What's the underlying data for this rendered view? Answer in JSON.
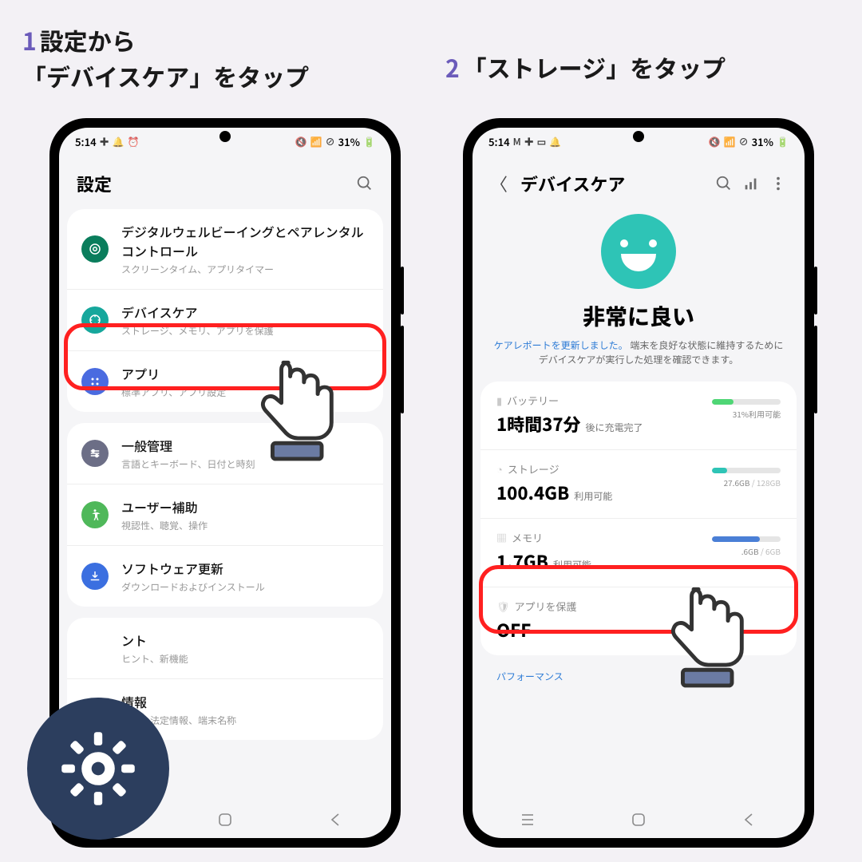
{
  "instructions": {
    "step1_num": "1",
    "step1_text": "設定から\n「デバイスケア」をタップ",
    "step2_num": "2",
    "step2_text": "「ストレージ」をタップ"
  },
  "status": {
    "time": "5:14",
    "battery": "31%"
  },
  "settings": {
    "title": "設定",
    "items": {
      "wellbeing": {
        "title": "デジタルウェルビーイングとペアレンタルコントロール",
        "sub": "スクリーンタイム、アプリタイマー"
      },
      "devicecare": {
        "title": "デバイスケア",
        "sub": "ストレージ、メモリ、アプリを保護"
      },
      "apps": {
        "title": "アプリ",
        "sub": "標準アプリ、アプリ設定"
      },
      "general": {
        "title": "一般管理",
        "sub": "言語とキーボード、日付と時刻"
      },
      "a11y": {
        "title": "ユーザー補助",
        "sub": "視認性、聴覚、操作"
      },
      "update": {
        "title": "ソフトウェア更新",
        "sub": "ダウンロードおよびインストール"
      },
      "tips": {
        "title": "ント",
        "sub": "ヒント、新機能"
      },
      "about": {
        "title": "情報",
        "sub": "タス、法定情報、端末名称"
      }
    }
  },
  "devicecare": {
    "title": "デバイスケア",
    "status_text": "非常に良い",
    "msg_link": "ケアレポートを更新しました。",
    "msg_rest": "端末を良好な状態に維持するためにデバイスケアが実行した処理を確認できます。",
    "battery": {
      "label": "バッテリー",
      "value": "1時間37分",
      "suffix": "後に充電完了",
      "caption": "31%利用可能",
      "fill_pct": 31,
      "fill_color": "#4fd675"
    },
    "storage": {
      "label": "ストレージ",
      "value": "100.4GB",
      "suffix": "利用可能",
      "used": "27.6GB",
      "total": "128GB",
      "fill_pct": 22,
      "fill_color": "#2ec4b6"
    },
    "memory": {
      "label": "メモリ",
      "value": "1.7GB",
      "suffix": "利用可能",
      "used": ".6GB",
      "total": "6GB",
      "fill_pct": 70,
      "fill_color": "#4a7fd6"
    },
    "protect": {
      "label": "アプリを保護",
      "value": "OFF"
    },
    "perf_label": "パフォーマンス"
  }
}
